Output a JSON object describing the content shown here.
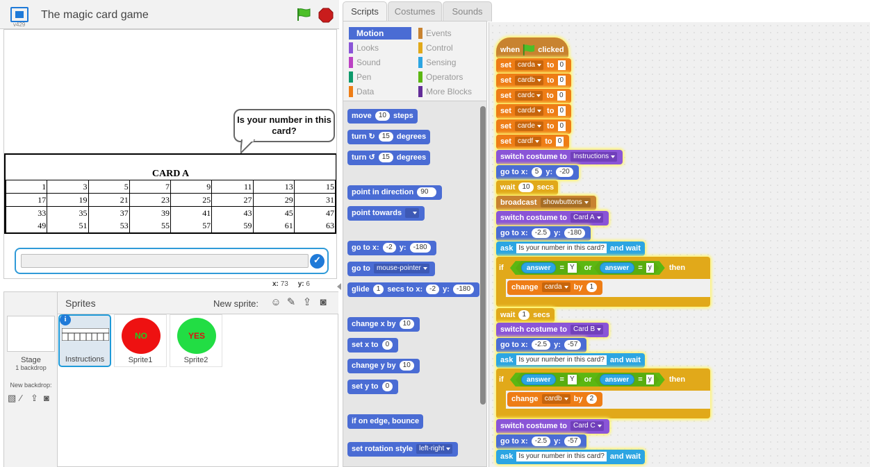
{
  "project": {
    "title": "The magic card game",
    "version": "v429"
  },
  "stage": {
    "bubble_text": "Is your number in this card?",
    "card": {
      "title": "CARD  A",
      "rows": [
        [
          "1",
          "3",
          "5",
          "7",
          "9",
          "11",
          "13",
          "15"
        ],
        [
          "17",
          "19",
          "21",
          "23",
          "25",
          "27",
          "29",
          "31"
        ],
        [
          "33",
          "35",
          "37",
          "39",
          "41",
          "43",
          "45",
          "47"
        ],
        [
          "49",
          "51",
          "53",
          "55",
          "57",
          "59",
          "61",
          "63"
        ]
      ]
    },
    "coords": {
      "x_label": "x:",
      "x": "73",
      "y_label": "y:",
      "y": "6"
    }
  },
  "sprites_panel": {
    "title": "Sprites",
    "new_sprite_label": "New sprite:",
    "stage_name": "Stage",
    "stage_backdrops": "1 backdrop",
    "new_backdrop_label": "New backdrop:",
    "sprites": [
      {
        "name": "Instructions",
        "selected": true
      },
      {
        "name": "Sprite1",
        "costume_text": "NO",
        "color": "#ee1111",
        "text_color": "#22cc22"
      },
      {
        "name": "Sprite2",
        "costume_text": "YES",
        "color": "#22dd44",
        "text_color": "#dd1111"
      }
    ]
  },
  "tabs": [
    "Scripts",
    "Costumes",
    "Sounds"
  ],
  "categories": [
    {
      "label": "Motion",
      "color": "#4a6cd4",
      "selected": true
    },
    {
      "label": "Events",
      "color": "#c88330"
    },
    {
      "label": "Looks",
      "color": "#8a55d7"
    },
    {
      "label": "Control",
      "color": "#e1a91a"
    },
    {
      "label": "Sound",
      "color": "#bb42c3"
    },
    {
      "label": "Sensing",
      "color": "#2ca5e2"
    },
    {
      "label": "Pen",
      "color": "#0e9a6c"
    },
    {
      "label": "Operators",
      "color": "#5cb712"
    },
    {
      "label": "Data",
      "color": "#ee7d16"
    },
    {
      "label": "More Blocks",
      "color": "#632d99"
    }
  ],
  "palette": {
    "move": {
      "a": "move",
      "n": "10",
      "b": "steps"
    },
    "turn_cw": {
      "a": "turn",
      "icon": "↻",
      "n": "15",
      "b": "degrees"
    },
    "turn_ccw": {
      "a": "turn",
      "icon": "↺",
      "n": "15",
      "b": "degrees"
    },
    "point_dir": {
      "a": "point in direction",
      "n": "90"
    },
    "point_towards": {
      "a": "point towards"
    },
    "goto_xy": {
      "a": "go to x:",
      "x": "-2",
      "b": "y:",
      "y": "-180"
    },
    "goto": {
      "a": "go to",
      "dd": "mouse-pointer"
    },
    "glide": {
      "a": "glide",
      "n": "1",
      "b": "secs to x:",
      "x": "-2",
      "c": "y:",
      "y": "-180"
    },
    "change_x": {
      "a": "change x by",
      "n": "10"
    },
    "set_x": {
      "a": "set x to",
      "n": "0"
    },
    "change_y": {
      "a": "change y by",
      "n": "10"
    },
    "set_y": {
      "a": "set y to",
      "n": "0"
    },
    "bounce": {
      "a": "if on edge, bounce"
    },
    "rotation": {
      "a": "set rotation style",
      "dd": "left-right"
    }
  },
  "script": {
    "hat": {
      "a": "when",
      "b": "clicked"
    },
    "sets": [
      {
        "a": "set",
        "var": "carda",
        "b": "to",
        "v": "0"
      },
      {
        "a": "set",
        "var": "cardb",
        "b": "to",
        "v": "0"
      },
      {
        "a": "set",
        "var": "cardc",
        "b": "to",
        "v": "0"
      },
      {
        "a": "set",
        "var": "cardd",
        "b": "to",
        "v": "0"
      },
      {
        "a": "set",
        "var": "carde",
        "b": "to",
        "v": "0"
      },
      {
        "a": "set",
        "var": "cardf",
        "b": "to",
        "v": "0"
      }
    ],
    "switch1": {
      "a": "switch costume to",
      "dd": "Instructions"
    },
    "goto1": {
      "a": "go to x:",
      "x": "5",
      "b": "y:",
      "y": "-20"
    },
    "wait1": {
      "a": "wait",
      "n": "10",
      "b": "secs"
    },
    "broadcast": {
      "a": "broadcast",
      "dd": "showbuttons"
    },
    "switch2": {
      "a": "switch costume to",
      "dd": "Card A"
    },
    "goto2": {
      "a": "go to x:",
      "x": "-2.5",
      "b": "y:",
      "y": "-180"
    },
    "ask1": {
      "a": "ask",
      "q": "Is your number in this card?",
      "b": "and wait"
    },
    "if1": {
      "a": "if",
      "p1": "answer",
      "eq": "=",
      "v1": "Y",
      "or": "or",
      "p2": "answer",
      "v2": "y",
      "then": "then"
    },
    "change1": {
      "a": "change",
      "dd": "carda",
      "b": "by",
      "n": "1"
    },
    "wait2": {
      "a": "wait",
      "n": "1",
      "b": "secs"
    },
    "switch3": {
      "a": "switch costume to",
      "dd": "Card B"
    },
    "goto3": {
      "a": "go to x:",
      "x": "-2.5",
      "b": "y:",
      "y": "-57"
    },
    "ask2": {
      "a": "ask",
      "q": "Is your number in this card?",
      "b": "and wait"
    },
    "if2": {
      "a": "if",
      "p1": "answer",
      "eq": "=",
      "v1": "Y",
      "or": "or",
      "p2": "answer",
      "v2": "y",
      "then": "then"
    },
    "change2": {
      "a": "change",
      "dd": "cardb",
      "b": "by",
      "n": "2"
    },
    "switch4": {
      "a": "switch costume to",
      "dd": "Card C"
    },
    "goto4": {
      "a": "go to x:",
      "x": "-2.5",
      "b": "y:",
      "y": "-57"
    },
    "ask3": {
      "a": "ask",
      "q": "Is your number in this card?",
      "b": "and wait"
    }
  }
}
